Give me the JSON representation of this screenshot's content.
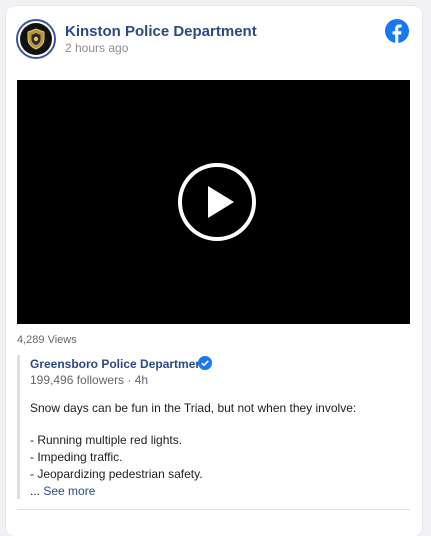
{
  "post": {
    "page_name": "Kinston Police Department",
    "timestamp": "2 hours ago",
    "views": "4,289 Views",
    "brand_color": "#1877f2",
    "link_color": "#2b4a84"
  },
  "icons": {
    "avatar": "police-badge-icon",
    "logo": "facebook-logo-icon",
    "play": "play-icon",
    "verified": "verified-badge-icon"
  },
  "shared_post": {
    "page_name": "Greensboro Police Department",
    "followers": "199,496 followers",
    "separator": " · ",
    "age": "4h",
    "intro": "Snow days can be fun in the Triad, but not when they involve:",
    "bullets": [
      "- Running multiple red lights.",
      "- Impeding traffic.",
      "- Jeopardizing pedestrian safety."
    ],
    "ellipsis": "... ",
    "see_more": "See more"
  }
}
